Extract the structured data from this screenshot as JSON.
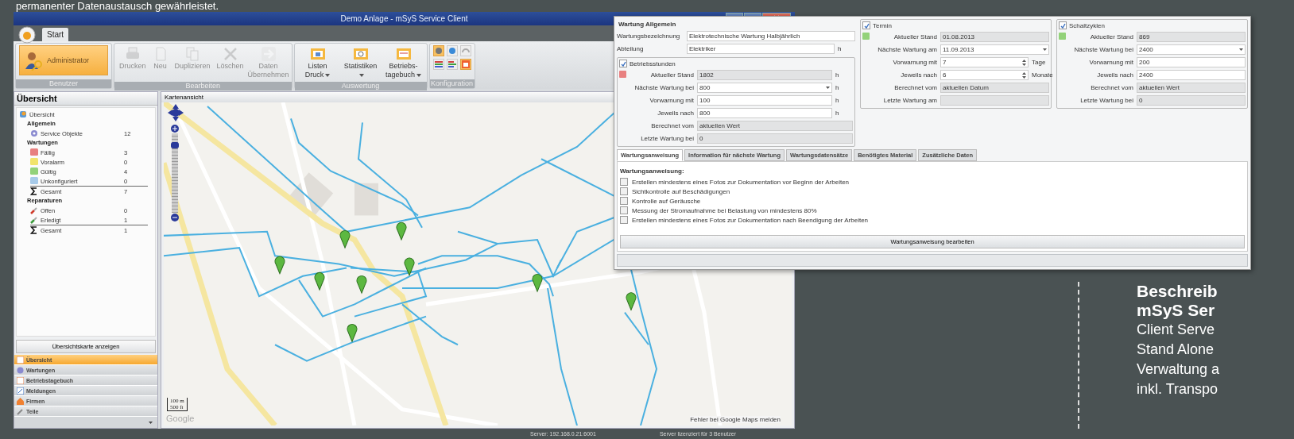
{
  "headline": "permanenter Datenaustausch gewährleistet.",
  "window": {
    "title": "Demo Anlage - mSyS Service Client"
  },
  "ribbon": {
    "tabs": [
      {
        "label": "Start",
        "selected": true
      }
    ],
    "groups": [
      {
        "label": "Benutzer",
        "items": [
          {
            "label": "Administrator",
            "kind": "user"
          }
        ]
      },
      {
        "label": "Bearbeiten",
        "items": [
          {
            "label": "Drucken",
            "kind": "print",
            "disabled": true,
            "dropdown": false
          },
          {
            "label": "Neu",
            "kind": "new",
            "disabled": true,
            "dropdown": false
          },
          {
            "label": "Duplizieren",
            "kind": "duplicate",
            "disabled": true,
            "dropdown": false
          },
          {
            "label": "Löschen",
            "kind": "delete",
            "disabled": true,
            "dropdown": false
          },
          {
            "label": "Daten Übernehmen",
            "kind": "transfer",
            "disabled": true,
            "dropdown": false
          }
        ]
      },
      {
        "label": "Auswertung",
        "items": [
          {
            "label": "Listen Druck",
            "kind": "list",
            "disabled": false,
            "dropdown": true
          },
          {
            "label": "Statistiken",
            "kind": "stats",
            "disabled": false,
            "dropdown": true
          },
          {
            "label": "Betriebs-tagebuch",
            "kind": "logbook",
            "disabled": false,
            "dropdown": true
          }
        ]
      },
      {
        "label": "Konfiguration",
        "items": [
          {
            "kind": "gray-ball",
            "selected": true
          },
          {
            "kind": "blue-ball",
            "selected": false
          },
          {
            "kind": "headset",
            "selected": false
          },
          {
            "kind": "bars",
            "selected": false
          },
          {
            "kind": "bars-arrow",
            "selected": false
          },
          {
            "kind": "calendar-list",
            "selected": true
          }
        ]
      }
    ]
  },
  "sidebar": {
    "title": "Übersicht",
    "tree": {
      "label": "Übersicht",
      "children": [
        {
          "label": "Allgemein",
          "children": [
            {
              "label": "Service Objekte",
              "kind": "gear",
              "count": "12"
            }
          ]
        },
        {
          "label": "Wartungen",
          "children": [
            {
              "label": "Fällig",
              "kind": "status",
              "color": "#e88080",
              "count": "3"
            },
            {
              "label": "Voralarm",
              "kind": "status",
              "color": "#f2e46c",
              "count": "0"
            },
            {
              "label": "Gültig",
              "kind": "status",
              "color": "#93d27a",
              "count": "4"
            },
            {
              "label": "Unkonfiguriert",
              "kind": "status",
              "color": "#a8cbea",
              "count": "0"
            },
            {
              "label": "Gesamt",
              "kind": "sum",
              "count": "7"
            }
          ]
        },
        {
          "label": "Reparaturen",
          "children": [
            {
              "label": "Offen",
              "kind": "wrench",
              "color": "#d03a2a",
              "count": "0"
            },
            {
              "label": "Erledigt",
              "kind": "wrench",
              "color": "#3a9a3a",
              "count": "1"
            },
            {
              "label": "Gesamt",
              "kind": "sum",
              "count": "1"
            }
          ]
        }
      ]
    },
    "map_button": "Übersichtskarte anzeigen",
    "nav": [
      {
        "label": "Übersicht",
        "kind": "calendar",
        "selected": true
      },
      {
        "label": "Wartungen",
        "kind": "gear",
        "selected": false
      },
      {
        "label": "Betriebstagebuch",
        "kind": "calendar",
        "selected": false
      },
      {
        "label": "Meldungen",
        "kind": "note",
        "selected": false
      },
      {
        "label": "Firmen",
        "kind": "house",
        "selected": false
      },
      {
        "label": "Teile",
        "kind": "tool",
        "selected": false
      }
    ]
  },
  "map": {
    "title": "Kartenansicht",
    "zoom": {
      "level": 0.88
    },
    "scale": [
      "100 m",
      "500 ft"
    ],
    "logo": "Google",
    "report_link": "Fehler bei Google Maps melden"
  },
  "status_bar": [
    "Server: 192.168.0.21:6001",
    "Server lizenziert für 3 Benutzer"
  ],
  "dialog": {
    "header": "Wartung Allgemein",
    "fields": [
      {
        "label": "Wartungsbezeichnung",
        "value": "Elektrotechnische Wartung Halbjährlich"
      },
      {
        "label": "Abteilung",
        "value": "Elektriker",
        "unit": "h"
      }
    ],
    "boxes": [
      {
        "title": "Betriebsstunden",
        "checked": true,
        "color": "#e88080",
        "rows": [
          {
            "label": "Aktueller Stand",
            "value": "1802",
            "kind": "readonly",
            "unit": "h"
          },
          {
            "label": "Nächste Wartung bei",
            "value": "800",
            "kind": "combo",
            "unit": "h"
          },
          {
            "label": "Vorwarnung mit",
            "value": "100",
            "kind": "text",
            "unit": "h"
          },
          {
            "label": "Jeweils nach",
            "value": "800",
            "kind": "text",
            "unit": "h"
          },
          {
            "label": "Berechnet vom",
            "value": "aktuellen Wert",
            "kind": "readonly"
          },
          {
            "label": "Letzte Wartung bei",
            "value": "0",
            "kind": "readonly"
          }
        ]
      },
      {
        "title": "Termin",
        "checked": true,
        "color": "#93d27a",
        "rows": [
          {
            "label": "Aktueller Stand",
            "value": "01.08.2013",
            "kind": "readonly"
          },
          {
            "label": "Nächste Wartung am",
            "value": "11.09.2013",
            "kind": "combo"
          },
          {
            "label": "Vorwarnung mit",
            "value": "7",
            "kind": "spin",
            "unit": "Tage"
          },
          {
            "label": "Jeweils nach",
            "value": "6",
            "kind": "spin",
            "unit": "Monate"
          },
          {
            "label": "Berechnet vom",
            "value": "aktuellen Datum",
            "kind": "readonly"
          },
          {
            "label": "Letzte Wartung am",
            "kind": "readonly"
          }
        ]
      },
      {
        "title": "Schaltzyklen",
        "checked": true,
        "color": "#93d27a",
        "rows": [
          {
            "label": "Aktueller Stand",
            "value": "869",
            "kind": "readonly"
          },
          {
            "label": "Nächste Wartung bei",
            "value": "2400",
            "kind": "combo"
          },
          {
            "label": "Vorwarnung mit",
            "value": "200",
            "kind": "text"
          },
          {
            "label": "Jeweils nach",
            "value": "2400",
            "kind": "text"
          },
          {
            "label": "Berechnet vom",
            "value": "aktuellen Wert",
            "kind": "readonly"
          },
          {
            "label": "Letzte Wartung bei",
            "value": "0",
            "kind": "readonly"
          }
        ]
      }
    ],
    "tabs": [
      {
        "label": "Wartungsanweisung",
        "selected": true
      },
      {
        "label": "Information für nächste Wartung",
        "selected": false
      },
      {
        "label": "Wartungsdatensätze",
        "selected": false
      },
      {
        "label": "Benötigtes Material",
        "selected": false
      },
      {
        "label": "Zusätzliche Daten",
        "selected": false
      }
    ],
    "instructions_title": "Wartungsanweisung:",
    "checklist": [
      {
        "label": "Erstellen mindestens eines Fotos zur Dokumentation vor Beginn der Arbeiten",
        "checked": false
      },
      {
        "label": "Sichtkontrolle auf Beschädigungen",
        "checked": false
      },
      {
        "label": "Kontrolle auf Geräusche",
        "checked": false
      },
      {
        "label": "Messung der Stromaufnahme bei Belastung von mindestens 80%",
        "checked": false
      },
      {
        "label": "Erstellen mindestens eines Fotos zur Dokumentation nach Beendigung der Arbeiten",
        "checked": false
      }
    ],
    "edit_button": "Wartungsanweisung bearbeiten"
  },
  "aside": {
    "title_lines": [
      "Beschreib",
      "mSyS Ser"
    ],
    "lines": [
      "Client Serve",
      "Stand Alone",
      "Verwaltung a",
      "inkl. Transpo"
    ]
  }
}
